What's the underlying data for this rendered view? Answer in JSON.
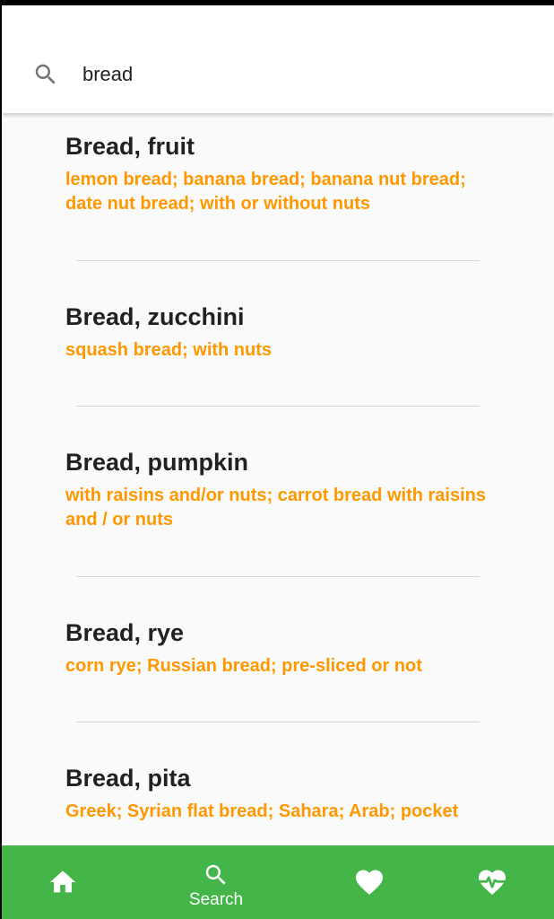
{
  "search": {
    "value": "bread",
    "icon": "search-icon"
  },
  "results": [
    {
      "title": "Bread, fruit",
      "description": "lemon bread; banana bread; banana nut bread; date nut bread; with or without nuts"
    },
    {
      "title": "Bread, zucchini",
      "description": "squash bread; with nuts"
    },
    {
      "title": "Bread, pumpkin",
      "description": "with raisins and/or nuts; carrot bread with raisins and / or nuts"
    },
    {
      "title": "Bread, rye",
      "description": "corn rye; Russian bread; pre-sliced or not"
    },
    {
      "title": "Bread, pita",
      "description": "Greek; Syrian flat bread; Sahara; Arab; pocket"
    }
  ],
  "bottom_nav": {
    "items": [
      {
        "icon": "home-icon",
        "label": ""
      },
      {
        "icon": "search-icon",
        "label": "Search"
      },
      {
        "icon": "heart-icon",
        "label": ""
      },
      {
        "icon": "heartbeat-icon",
        "label": ""
      }
    ]
  },
  "colors": {
    "accent": "#ff9800",
    "nav_background": "#43b549",
    "title_text": "#212121",
    "background": "#fafafa"
  }
}
